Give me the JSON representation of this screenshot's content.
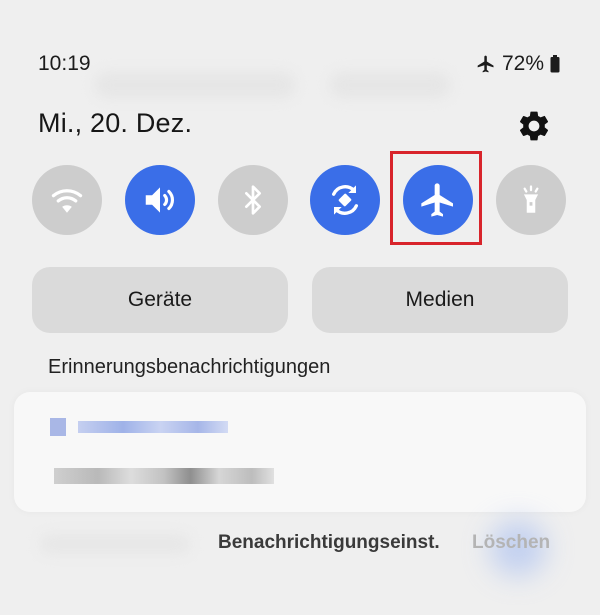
{
  "status_bar": {
    "time": "10:19",
    "battery": "72%"
  },
  "header": {
    "date": "Mi., 20. Dez."
  },
  "quick_tiles": [
    {
      "name": "wifi-tile",
      "icon": "wifi-icon",
      "state": "off"
    },
    {
      "name": "sound-tile",
      "icon": "speaker-icon",
      "state": "on"
    },
    {
      "name": "bluetooth-tile",
      "icon": "bluetooth-icon",
      "state": "off"
    },
    {
      "name": "auto-rotate-tile",
      "icon": "auto-rotate-icon",
      "state": "on"
    },
    {
      "name": "airplane-mode-tile",
      "icon": "airplane-icon",
      "state": "on",
      "highlighted": true
    },
    {
      "name": "flashlight-tile",
      "icon": "flashlight-icon",
      "state": "off"
    }
  ],
  "buttons": {
    "devices": "Geräte",
    "media": "Medien"
  },
  "notifications": {
    "section_title": "Erinnerungsbenachrichtigungen"
  },
  "footer": {
    "notification_settings": "Benachrichtigungseinst.",
    "clear": "Löschen"
  },
  "colors": {
    "accent": "#3a6ee8",
    "tile_off": "#cdcdcd",
    "highlight": "#d8242b",
    "background": "#efefef"
  }
}
